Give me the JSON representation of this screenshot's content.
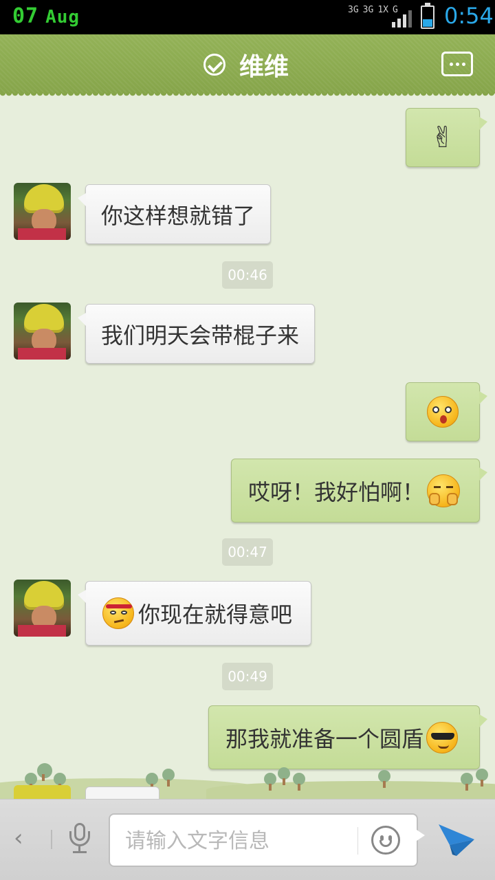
{
  "status_bar": {
    "day": "07",
    "month": "Aug",
    "network_top": [
      "3G",
      "3G",
      "1X",
      "G"
    ],
    "time": "0:54",
    "battery_level": 0.3,
    "battery_color": "#2aa8e8",
    "date_color": "#33cc33"
  },
  "header": {
    "title": "维维",
    "verified_icon": "check-circle-icon",
    "more_icon": "chat-bubble-more-icon",
    "background": "#8daa51"
  },
  "messages": [
    {
      "side": "out",
      "type": "emoji",
      "emoji": "victory-hand"
    },
    {
      "side": "in",
      "text": "你这样想就错了"
    },
    {
      "type": "time",
      "text": "00:46"
    },
    {
      "side": "in",
      "text": "我们明天会带棍子来"
    },
    {
      "side": "out",
      "type": "emoji",
      "emoji": "shocked-face"
    },
    {
      "side": "out",
      "text": "哎呀！我好怕啊！",
      "emoji": "scared-face"
    },
    {
      "type": "time",
      "text": "00:47"
    },
    {
      "side": "in",
      "text": "你现在就得意吧",
      "emoji": "annoyed-face"
    },
    {
      "type": "time",
      "text": "00:49"
    },
    {
      "side": "out",
      "text": "那我就准备一个圆盾",
      "emoji": "cool-sunglasses-face"
    }
  ],
  "input_bar": {
    "placeholder": "请输入文字信息",
    "value": "",
    "back_icon": "chevron-left-icon",
    "voice_icon": "microphone-icon",
    "emoji_icon": "smiley-icon",
    "send_icon": "paper-plane-icon",
    "send_color": "#2f86d6"
  }
}
